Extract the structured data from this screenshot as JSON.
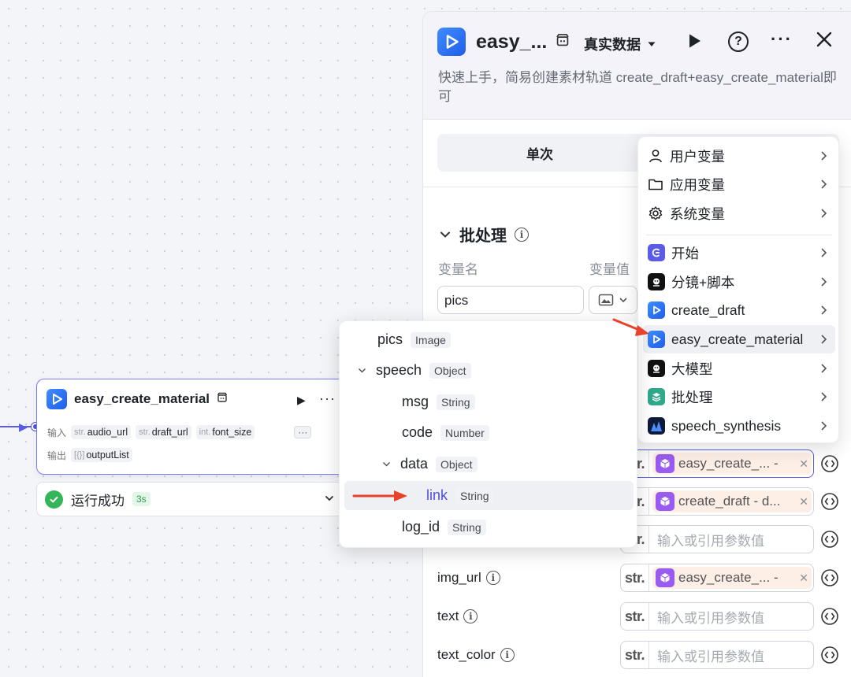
{
  "node": {
    "title": "easy_create_material",
    "input_label": "输入",
    "output_label": "输出",
    "inputs": [
      {
        "type": "str.",
        "name": "audio_url"
      },
      {
        "type": "str.",
        "name": "draft_url"
      },
      {
        "type": "int.",
        "name": "font_size"
      }
    ],
    "more_inputs": "···",
    "output": {
      "type": "[{}]",
      "name": "outputList"
    },
    "run_status": "运行成功",
    "run_time": "3s"
  },
  "panel": {
    "title": "easy_...",
    "data_select": "真实数据",
    "description": "快速上手，简易创建素材轨道 create_draft+easy_create_material即可",
    "tab_single": "单次",
    "batch_title": "批处理",
    "col_var_name": "变量名",
    "col_var_value": "变量值",
    "pics_value": "pics",
    "params": [
      {
        "label": "",
        "mode": "ref",
        "chip": "easy_create_... -",
        "active": true
      },
      {
        "label": "",
        "mode": "ref",
        "chip": "create_draft - d..."
      },
      {
        "label": "",
        "mode": "input",
        "placeholder": "输入或引用参数值"
      },
      {
        "label": "img_url",
        "mode": "ref",
        "chip": "easy_create_... -"
      },
      {
        "label": "text",
        "mode": "input",
        "placeholder": "输入或引用参数值"
      },
      {
        "label": "text_color",
        "mode": "input",
        "placeholder": "输入或引用参数值"
      }
    ],
    "str_tag": "str."
  },
  "source_menu": {
    "items": [
      {
        "label": "用户变量",
        "icon": "user-icon"
      },
      {
        "label": "应用变量",
        "icon": "folder-icon"
      },
      {
        "label": "系统变量",
        "icon": "gear-icon"
      },
      {
        "label": "开始",
        "icon": "start-icon"
      },
      {
        "label": "分镜+脚本",
        "icon": "model-icon"
      },
      {
        "label": "create_draft",
        "icon": "app-logo-icon"
      },
      {
        "label": "easy_create_material",
        "icon": "app-logo-icon"
      },
      {
        "label": "大模型",
        "icon": "model-icon"
      },
      {
        "label": "批处理",
        "icon": "batch-icon"
      },
      {
        "label": "speech_synthesis",
        "icon": "wave-icon"
      }
    ],
    "highlighted_index": 6
  },
  "output_tree": {
    "rows": [
      {
        "name": "pics",
        "type": "Image",
        "depth": 0,
        "expand": false
      },
      {
        "name": "speech",
        "type": "Object",
        "depth": 0,
        "expand": true
      },
      {
        "name": "msg",
        "type": "String",
        "depth": 1,
        "expand": false
      },
      {
        "name": "code",
        "type": "Number",
        "depth": 1,
        "expand": false
      },
      {
        "name": "data",
        "type": "Object",
        "depth": 1,
        "expand": true
      },
      {
        "name": "link",
        "type": "String",
        "depth": 2,
        "expand": false
      },
      {
        "name": "log_id",
        "type": "String",
        "depth": 1,
        "expand": false
      }
    ],
    "selected_index": 5
  },
  "colors": {
    "accent": "#4e4fdc",
    "success": "#34b55a",
    "arrow": "#e8412c",
    "chip_bg": "#fdeee6",
    "cube": "#9a5cf0"
  }
}
